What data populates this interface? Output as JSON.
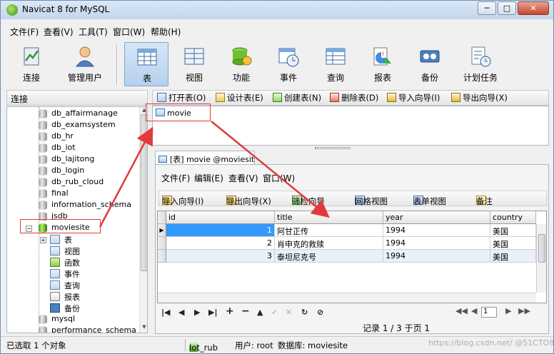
{
  "window": {
    "title": "Navicat 8 for MySQL",
    "minimize": "─",
    "maximize": "□",
    "close": "✕"
  },
  "menu": [
    "文件(F)",
    "查看(V)",
    "工具(T)",
    "窗口(W)",
    "帮助(H)"
  ],
  "toolbar": [
    {
      "label": "连接",
      "icon": "connection-icon"
    },
    {
      "label": "管理用户",
      "icon": "user-icon"
    },
    {
      "label": "表",
      "icon": "table-icon",
      "active": true
    },
    {
      "label": "视图",
      "icon": "view-icon"
    },
    {
      "label": "功能",
      "icon": "function-icon"
    },
    {
      "label": "事件",
      "icon": "event-icon"
    },
    {
      "label": "查询",
      "icon": "query-icon"
    },
    {
      "label": "报表",
      "icon": "report-icon"
    },
    {
      "label": "备份",
      "icon": "backup-icon"
    },
    {
      "label": "计划任务",
      "icon": "schedule-icon"
    }
  ],
  "left_panel": {
    "header": "连接",
    "databases": [
      "db_affairmanage",
      "db_examsystem",
      "db_hr",
      "db_iot",
      "db_lajitong",
      "db_login",
      "db_rub_cloud",
      "final",
      "information_schema",
      "jsdb",
      "moviesite"
    ],
    "open_db": "moviesite",
    "expand_symbol": "−",
    "children": [
      "表",
      "视图",
      "函数",
      "事件",
      "查询",
      "报表",
      "备份"
    ],
    "child_expand_symbol": "+",
    "after": [
      "mysql",
      "performance_schema"
    ],
    "scroll_up": "▲",
    "scroll_down": "▼"
  },
  "object_toolbar": [
    "打开表(O)",
    "设计表(E)",
    "创建表(N)",
    "删除表(D)",
    "导入向导(I)",
    "导出向导(X)"
  ],
  "objects": [
    "movie"
  ],
  "table_window": {
    "tab_title": "[表] movie @moviesite (I...",
    "menu": [
      "文件(F)",
      "编辑(E)",
      "查看(V)",
      "窗口(W)"
    ],
    "tools": [
      "导入向导(I)",
      "导出向导(X)",
      "筛检向导",
      "网格视图",
      "表单视图",
      "备注"
    ],
    "columns": [
      "id",
      "title",
      "year",
      "country"
    ],
    "rows": [
      {
        "id": "1",
        "title": "阿甘正传",
        "year": "1994",
        "country": "美国"
      },
      {
        "id": "2",
        "title": "肖申克的救赎",
        "year": "1994",
        "country": "美国"
      },
      {
        "id": "3",
        "title": "泰坦尼克号",
        "year": "1994",
        "country": "美国"
      }
    ],
    "current_row_marker": "▶",
    "nav_buttons": [
      "|◀",
      "◀",
      "▶",
      "▶|",
      "+",
      "−",
      "▲",
      "✓",
      "✕",
      "↻",
      "⊘"
    ],
    "pager": {
      "first": "◀◀",
      "prev": "◀",
      "page": "1",
      "next": "▶",
      "last": "▶▶"
    },
    "record_status": "记录 1 / 3 于页 1"
  },
  "statusbar": {
    "selected": "已选取 1 个对象",
    "connection": "Iot_rub",
    "user": "用户: root",
    "database": "数据库: moviesite"
  },
  "watermark": "https://blog.csdn.net/ @51CTO博客",
  "colors": {
    "accent": "#3399ff",
    "highlight": "#e23a3a"
  }
}
